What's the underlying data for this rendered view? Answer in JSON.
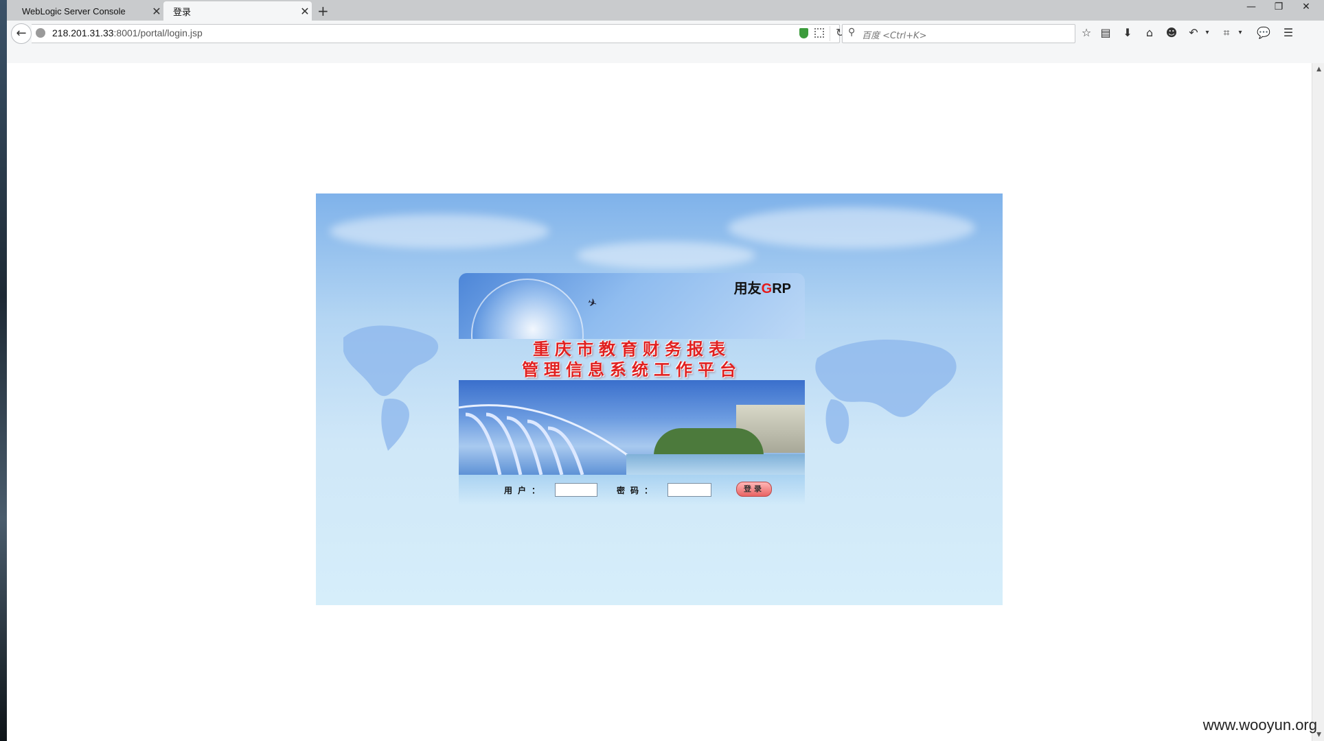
{
  "tabs": [
    {
      "label": "WebLogic Server Console"
    },
    {
      "label": "登录"
    }
  ],
  "address_bar": {
    "host": "218.201.31.33",
    "path": ":8001/portal/login.jsp"
  },
  "search": {
    "placeholder": "百度 <Ctrl+K>"
  },
  "login": {
    "brand_prefix": "用友",
    "brand_g": "G",
    "brand_suffix": "RP",
    "title_line1": "重庆市教育财务报表",
    "title_line2": "管理信息系统工作平台",
    "user_label": "用户：",
    "password_label": "密码：",
    "login_button": "登录"
  },
  "watermark": "www.wooyun.org",
  "colors": {
    "title_red": "#e02020",
    "brand_red": "#e51a1a",
    "sky_blue": "#7fb2ea"
  }
}
